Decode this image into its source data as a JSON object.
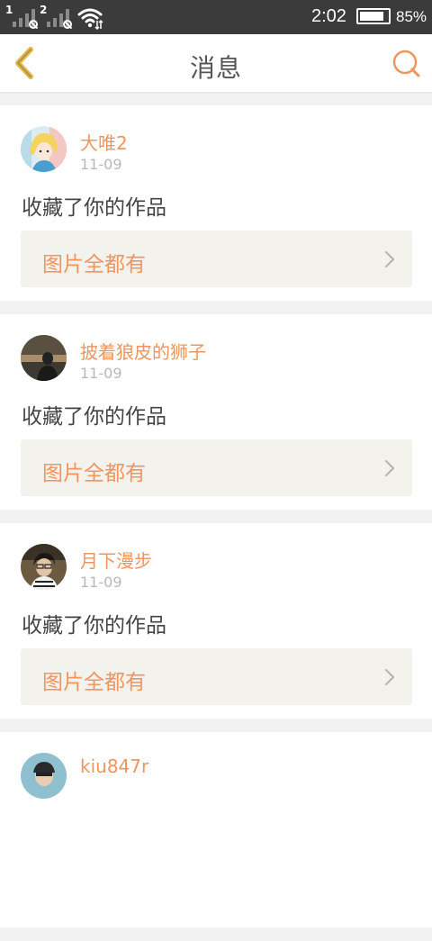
{
  "status_bar": {
    "sim1": "1",
    "sim2": "2",
    "time": "2:02",
    "battery_percent": "85%",
    "battery_level": 0.85,
    "icons": [
      "signal-icon",
      "no-sim-icon",
      "wifi-icon",
      "battery-icon"
    ]
  },
  "header": {
    "title": "消息",
    "back_icon": "chevron-left-icon",
    "search_icon": "search-icon"
  },
  "colors": {
    "accent": "#f0955e",
    "back": "#e6b84a",
    "status_bar_bg": "#3b3b3b"
  },
  "messages": [
    {
      "user": "大唯2",
      "date": "11-09",
      "action": "收藏了你的作品",
      "work": "图片全都有"
    },
    {
      "user": "披着狼皮的狮子",
      "date": "11-09",
      "action": "收藏了你的作品",
      "work": "图片全都有"
    },
    {
      "user": "月下漫步",
      "date": "11-09",
      "action": "收藏了你的作品",
      "work": "图片全都有"
    },
    {
      "user": "kiu847r",
      "date": "",
      "action": "",
      "work": ""
    }
  ]
}
